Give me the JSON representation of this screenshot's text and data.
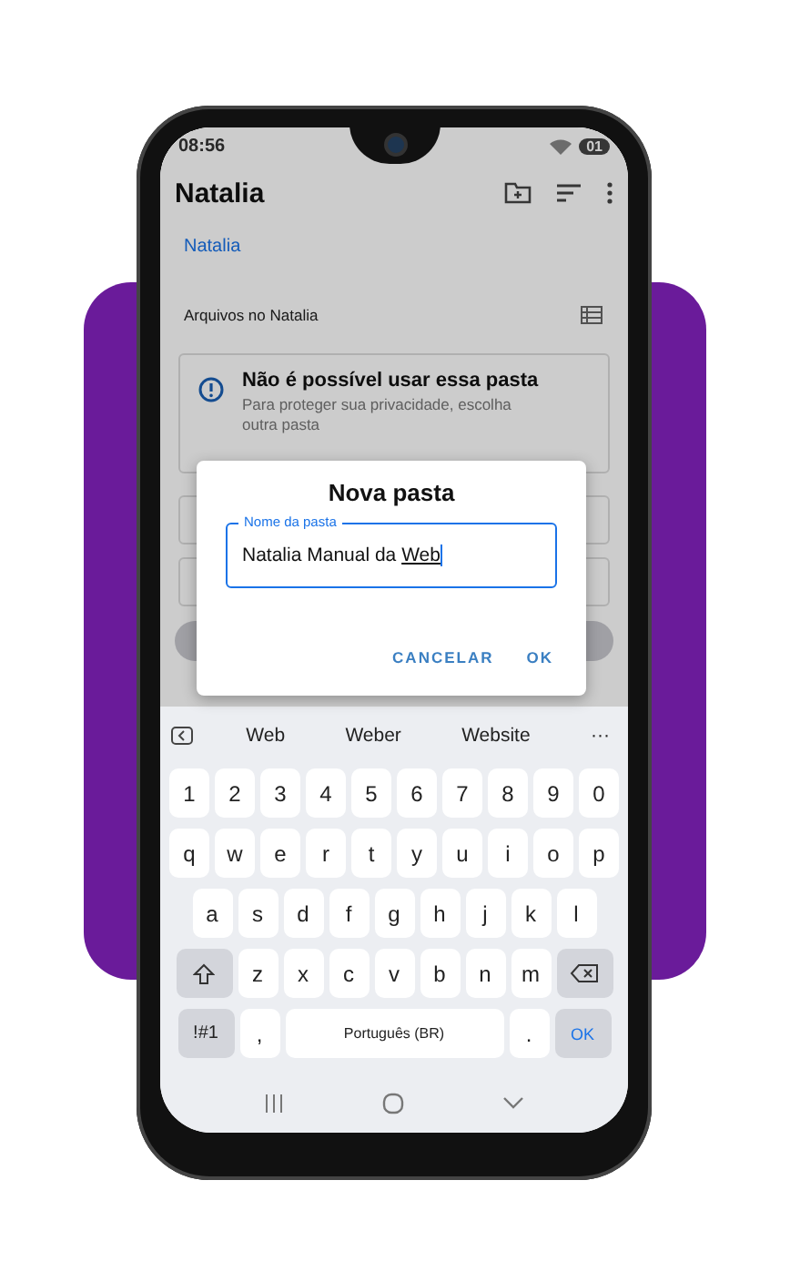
{
  "status_bar": {
    "time": "08:56",
    "battery": "01"
  },
  "app_bar": {
    "title": "Natalia"
  },
  "breadcrumb": "Natalia",
  "section": {
    "title": "Arquivos no Natalia"
  },
  "warning_card": {
    "title": "Não é possível usar essa pasta",
    "message": "Para proteger sua privacidade, escolha outra pasta"
  },
  "dialog": {
    "title": "Nova pasta",
    "field": {
      "label": "Nome da pasta",
      "value": "Natalia Manual da Web"
    },
    "buttons": [
      "CANCELAR",
      "OK"
    ]
  },
  "keyboard": {
    "suggestions": [
      "Web",
      "Weber",
      "Website"
    ],
    "more": "···",
    "rows": [
      [
        "1",
        "2",
        "3",
        "4",
        "5",
        "6",
        "7",
        "8",
        "9",
        "0"
      ],
      [
        "q",
        "w",
        "e",
        "r",
        "t",
        "y",
        "u",
        "i",
        "o",
        "p"
      ],
      [
        "a",
        "s",
        "d",
        "f",
        "g",
        "h",
        "j",
        "k",
        "l"
      ],
      [
        "z",
        "x",
        "c",
        "v",
        "b",
        "n",
        "m"
      ]
    ],
    "bottom": {
      "symbols": "!#1",
      "comma": ",",
      "space": "Português (BR)",
      "period": ".",
      "enter": "OK"
    }
  }
}
